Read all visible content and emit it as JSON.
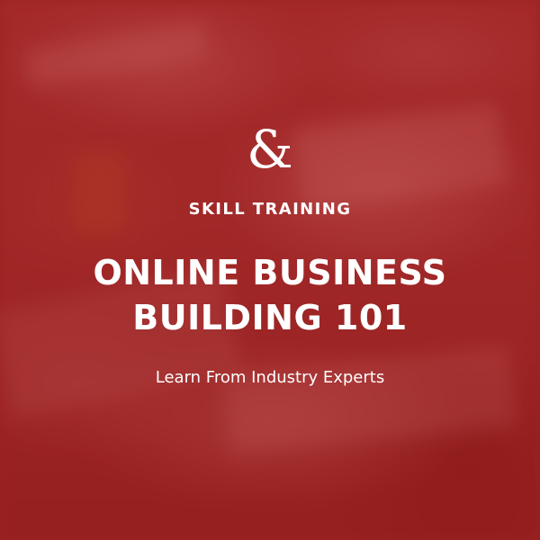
{
  "logo": {
    "symbol": "&",
    "icon": "ampersand-icon"
  },
  "eyebrow": "SKILL TRAINING",
  "title": {
    "line1": "ONLINE BUSINESS",
    "line2": "BUILDING 101"
  },
  "subtitle": "Learn From Industry Experts",
  "colors": {
    "background": "#9a2424",
    "text": "#ffffff"
  }
}
